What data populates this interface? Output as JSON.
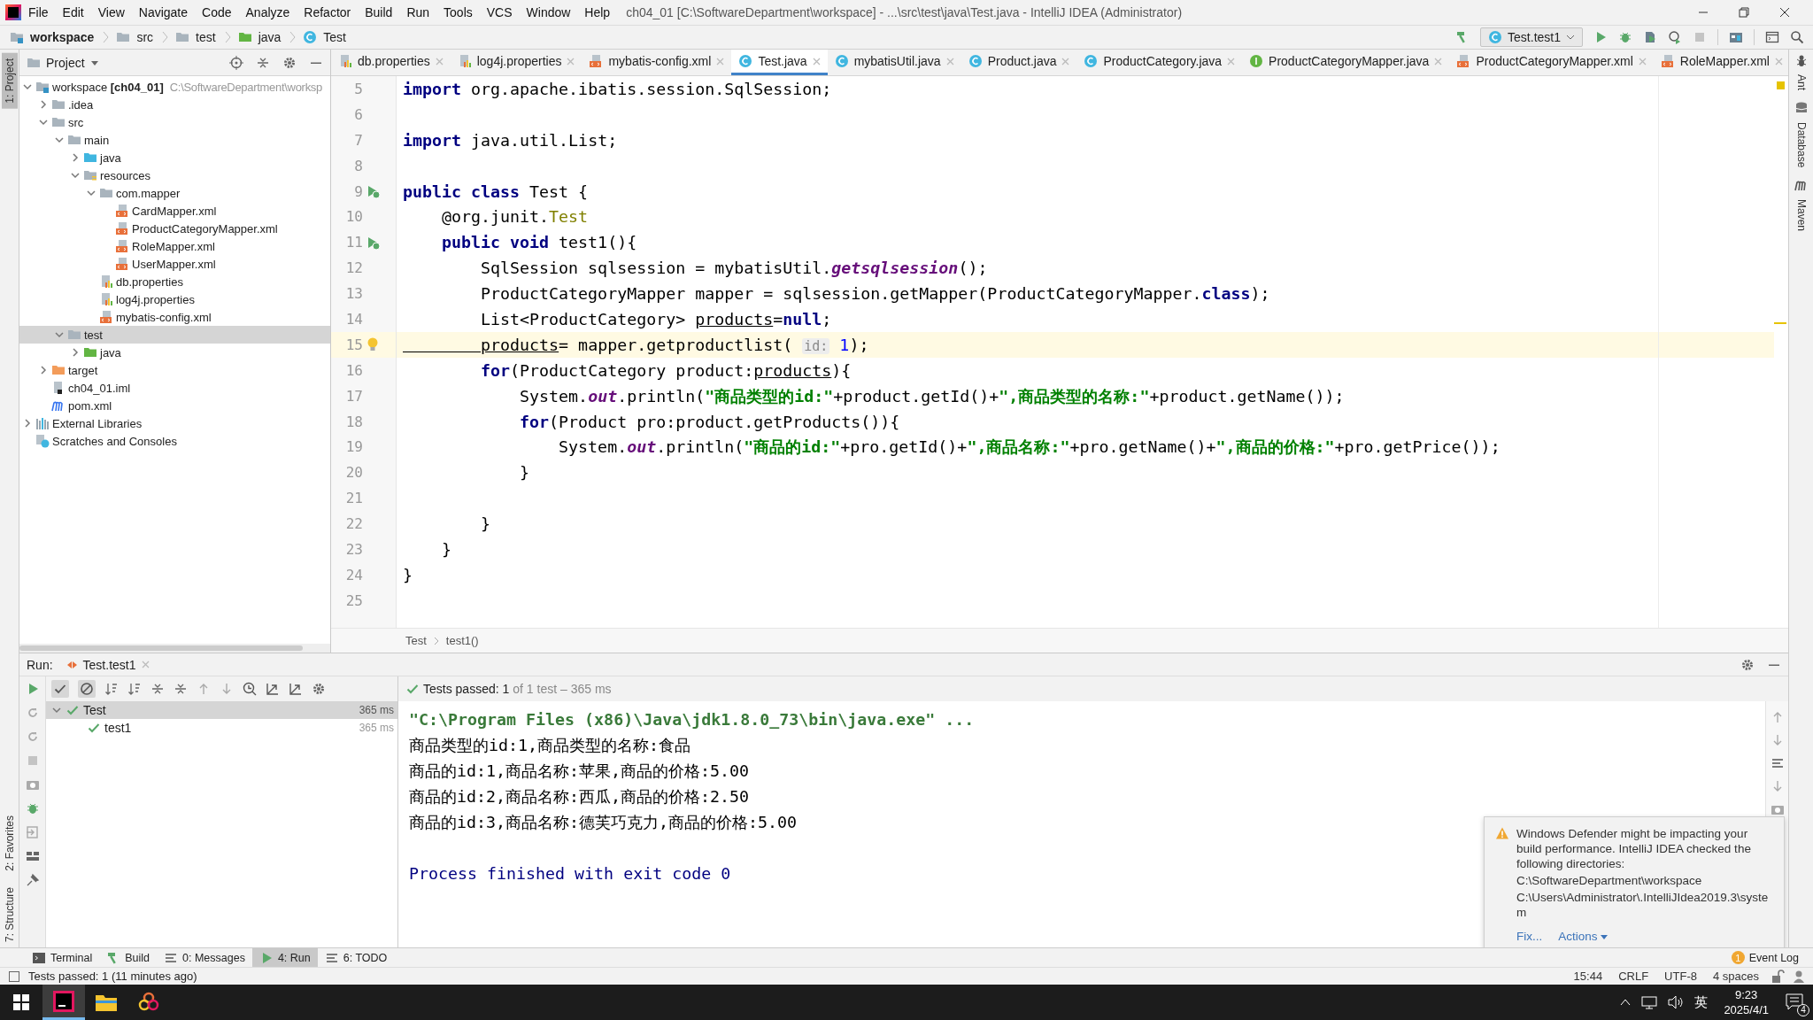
{
  "window": {
    "title": "ch04_01 [C:\\SoftwareDepartment\\workspace] - ...\\src\\test\\java\\Test.java - IntelliJ IDEA (Administrator)",
    "menu": [
      "File",
      "Edit",
      "View",
      "Navigate",
      "Code",
      "Analyze",
      "Refactor",
      "Build",
      "Run",
      "Tools",
      "VCS",
      "Window",
      "Help"
    ]
  },
  "navbar": {
    "crumbs": [
      {
        "label": "workspace",
        "kind": "module"
      },
      {
        "label": "src",
        "kind": "folder"
      },
      {
        "label": "test",
        "kind": "folder"
      },
      {
        "label": "java",
        "kind": "test-folder"
      },
      {
        "label": "Test",
        "kind": "class"
      }
    ],
    "run_config": "Test.test1"
  },
  "left_stripe": [
    {
      "label": "1: Project",
      "selected": true
    },
    {
      "label": "2: Favorites",
      "selected": false
    },
    {
      "label": "7: Structure",
      "selected": false
    }
  ],
  "right_stripe": [
    "Ant",
    "Database",
    "Maven"
  ],
  "project": {
    "title": "Project",
    "tree": [
      {
        "label": "workspace **[ch04_01]**",
        "path": "C:\\SoftwareDepartment\\worksp",
        "kind": "module",
        "expanded": true,
        "selected": false,
        "children": [
          {
            "label": ".idea",
            "kind": "folder",
            "expanded": false,
            "selected": false
          },
          {
            "label": "src",
            "kind": "folder",
            "expanded": true,
            "selected": false,
            "children": [
              {
                "label": "main",
                "kind": "folder",
                "expanded": true,
                "selected": false,
                "children": [
                  {
                    "label": "java",
                    "kind": "src-folder",
                    "expanded": false,
                    "selected": false
                  },
                  {
                    "label": "resources",
                    "kind": "res-folder",
                    "expanded": true,
                    "selected": false,
                    "children": [
                      {
                        "label": "com.mapper",
                        "kind": "folder",
                        "expanded": true,
                        "selected": false,
                        "children": [
                          {
                            "label": "CardMapper.xml",
                            "kind": "xml",
                            "selected": false
                          },
                          {
                            "label": "ProductCategoryMapper.xml",
                            "kind": "xml",
                            "selected": false
                          },
                          {
                            "label": "RoleMapper.xml",
                            "kind": "xml",
                            "selected": false
                          },
                          {
                            "label": "UserMapper.xml",
                            "kind": "xml",
                            "selected": false
                          }
                        ]
                      },
                      {
                        "label": "db.properties",
                        "kind": "properties",
                        "selected": false
                      },
                      {
                        "label": "log4j.properties",
                        "kind": "properties",
                        "selected": false
                      },
                      {
                        "label": "mybatis-config.xml",
                        "kind": "xml",
                        "selected": false
                      }
                    ]
                  }
                ]
              },
              {
                "label": "test",
                "kind": "folder",
                "expanded": true,
                "selected": true,
                "children": [
                  {
                    "label": "java",
                    "kind": "test-folder",
                    "expanded": false,
                    "selected": false
                  }
                ]
              }
            ]
          },
          {
            "label": "target",
            "kind": "excluded-folder",
            "expanded": false,
            "selected": false
          },
          {
            "label": "ch04_01.iml",
            "kind": "iml",
            "selected": false
          },
          {
            "label": "pom.xml",
            "kind": "pom",
            "selected": false
          }
        ]
      },
      {
        "label": "External Libraries",
        "kind": "libraries",
        "expanded": false,
        "selected": false
      },
      {
        "label": "Scratches and Consoles",
        "kind": "scratches",
        "selected": false
      }
    ]
  },
  "editor": {
    "tabs": [
      {
        "label": "db.properties",
        "kind": "properties",
        "selected": false
      },
      {
        "label": "log4j.properties",
        "kind": "properties",
        "selected": false
      },
      {
        "label": "mybatis-config.xml",
        "kind": "xml",
        "selected": false
      },
      {
        "label": "Test.java",
        "kind": "class",
        "selected": true
      },
      {
        "label": "mybatisUtil.java",
        "kind": "class",
        "selected": false
      },
      {
        "label": "Product.java",
        "kind": "class",
        "selected": false
      },
      {
        "label": "ProductCategory.java",
        "kind": "class",
        "selected": false
      },
      {
        "label": "ProductCategoryMapper.java",
        "kind": "interface",
        "selected": false
      },
      {
        "label": "ProductCategoryMapper.xml",
        "kind": "xml",
        "selected": false
      },
      {
        "label": "RoleMapper.xml",
        "kind": "xml",
        "selected": false
      }
    ],
    "lines": [
      {
        "number": "5",
        "kind": "code",
        "current": false,
        "tokens": [
          {
            "kind": "kw",
            "text": "import"
          },
          {
            "kind": "plain",
            "text": " org.apache.ibatis.session.SqlSession;"
          }
        ]
      },
      {
        "number": "6",
        "kind": "code",
        "current": false
      },
      {
        "number": "7",
        "kind": "code",
        "current": false,
        "tokens": [
          {
            "kind": "kw",
            "text": "import"
          },
          {
            "kind": "plain",
            "text": " java.util.List;"
          }
        ]
      },
      {
        "number": "8",
        "kind": "code",
        "current": false
      },
      {
        "number": "9",
        "kind": "run",
        "current": false,
        "tokens": [
          {
            "kind": "kw",
            "text": "public class"
          },
          {
            "kind": "plain",
            "text": " Test {"
          }
        ]
      },
      {
        "number": "10",
        "kind": "code",
        "current": false,
        "tokens": [
          {
            "kind": "plain",
            "text": "    @org.junit."
          },
          {
            "kind": "ann",
            "text": "Test"
          }
        ]
      },
      {
        "number": "11",
        "kind": "run",
        "current": false,
        "tokens": [
          {
            "kind": "kw",
            "text": "    public void"
          },
          {
            "kind": "plain",
            "text": " test1(){"
          }
        ]
      },
      {
        "number": "12",
        "kind": "code",
        "current": false,
        "tokens": [
          {
            "kind": "plain",
            "text": "        SqlSession sqlsession = mybatisUtil."
          },
          {
            "kind": "italic",
            "text": "getsqlsession"
          },
          {
            "kind": "plain",
            "text": "();"
          }
        ]
      },
      {
        "number": "13",
        "kind": "code",
        "current": false,
        "tokens": [
          {
            "kind": "plain",
            "text": "        ProductCategoryMapper mapper = sqlsession.getMapper(ProductCategoryMapper."
          },
          {
            "kind": "kw",
            "text": "class"
          },
          {
            "kind": "plain",
            "text": ");"
          }
        ]
      },
      {
        "number": "14",
        "kind": "code",
        "current": false,
        "tokens": [
          {
            "kind": "plain",
            "text": "        List<ProductCategory> "
          },
          {
            "kind": "var",
            "text": "products"
          },
          {
            "kind": "plain",
            "text": "="
          },
          {
            "kind": "kw",
            "text": "null"
          },
          {
            "kind": "plain",
            "text": ";"
          }
        ]
      },
      {
        "number": "15",
        "kind": "bulb",
        "current": true,
        "tokens": [
          {
            "kind": "var",
            "text": "        products"
          },
          {
            "kind": "plain",
            "text": "= mapper.getproductlist( "
          },
          {
            "kind": "hint",
            "text": "id:"
          },
          {
            "kind": "num",
            "text": " 1"
          },
          {
            "kind": "plain",
            "text": ");"
          }
        ]
      },
      {
        "number": "16",
        "kind": "code",
        "current": false,
        "tokens": [
          {
            "kind": "kw",
            "text": "        for"
          },
          {
            "kind": "plain",
            "text": "(ProductCategory product:"
          },
          {
            "kind": "var",
            "text": "products"
          },
          {
            "kind": "plain",
            "text": "){"
          }
        ]
      },
      {
        "number": "17",
        "kind": "code",
        "current": false,
        "tokens": [
          {
            "kind": "plain",
            "text": "            System."
          },
          {
            "kind": "italic",
            "text": "out"
          },
          {
            "kind": "plain",
            "text": ".println("
          },
          {
            "kind": "str",
            "text": "\"商品类型的id:\""
          },
          {
            "kind": "plain",
            "text": "+product.getId()+"
          },
          {
            "kind": "str",
            "text": "\",商品类型的名称:\""
          },
          {
            "kind": "plain",
            "text": "+product.getName());"
          }
        ]
      },
      {
        "number": "18",
        "kind": "code",
        "current": false,
        "tokens": [
          {
            "kind": "kw",
            "text": "            for"
          },
          {
            "kind": "plain",
            "text": "(Product pro:product.getProducts()){"
          }
        ]
      },
      {
        "number": "19",
        "kind": "code",
        "current": false,
        "tokens": [
          {
            "kind": "plain",
            "text": "                System."
          },
          {
            "kind": "italic",
            "text": "out"
          },
          {
            "kind": "plain",
            "text": ".println("
          },
          {
            "kind": "str",
            "text": "\"商品的id:\""
          },
          {
            "kind": "plain",
            "text": "+pro.getId()+"
          },
          {
            "kind": "str",
            "text": "\",商品名称:\""
          },
          {
            "kind": "plain",
            "text": "+pro.getName()+"
          },
          {
            "kind": "str",
            "text": "\",商品的价格:\""
          },
          {
            "kind": "plain",
            "text": "+pro.getPrice());"
          }
        ]
      },
      {
        "number": "20",
        "kind": "code",
        "current": false,
        "tokens": [
          {
            "kind": "plain",
            "text": "            }"
          }
        ]
      },
      {
        "number": "21",
        "kind": "code",
        "current": false
      },
      {
        "number": "22",
        "kind": "code",
        "current": false,
        "tokens": [
          {
            "kind": "plain",
            "text": "        }"
          }
        ]
      },
      {
        "number": "23",
        "kind": "code",
        "current": false,
        "tokens": [
          {
            "kind": "plain",
            "text": "    }"
          }
        ]
      },
      {
        "number": "24",
        "kind": "code",
        "current": false,
        "tokens": [
          {
            "kind": "plain",
            "text": "}"
          }
        ]
      },
      {
        "number": "25",
        "kind": "code",
        "current": false
      }
    ],
    "breadcrumbs": [
      "Test",
      "test1()"
    ]
  },
  "run": {
    "title": "Run:",
    "tab": "Test.test1",
    "status": "Tests passed: 1",
    "status_detail": "of 1 test – 365 ms",
    "tests": [
      {
        "name": "Test",
        "time": "365 ms",
        "selected": true,
        "children": [
          {
            "name": "test1",
            "time": "365 ms",
            "selected": false
          }
        ]
      }
    ],
    "console": [
      {
        "kind": "command",
        "text": "\"C:\\Program Files (x86)\\Java\\jdk1.8.0_73\\bin\\java.exe\" ..."
      },
      {
        "kind": "output",
        "text": "商品类型的id:1,商品类型的名称:食品"
      },
      {
        "kind": "output",
        "text": "商品的id:1,商品名称:苹果,商品的价格:5.00"
      },
      {
        "kind": "output",
        "text": "商品的id:2,商品名称:西瓜,商品的价格:2.50"
      },
      {
        "kind": "output",
        "text": "商品的id:3,商品名称:德芙巧克力,商品的价格:5.00"
      },
      {
        "kind": "exit",
        "text": "Process finished with exit code 0"
      }
    ]
  },
  "notification": {
    "message": "Windows Defender might be impacting your build performance. IntelliJ IDEA checked the following directories:",
    "paths": [
      "C:\\SoftwareDepartment\\workspace",
      "C:\\Users\\Administrator\\.IntelliJIdea2019.3\\system"
    ],
    "links": [
      "Fix...",
      "Actions"
    ]
  },
  "tool_tabs": [
    {
      "label": "Terminal",
      "kind": "terminal",
      "selected": false
    },
    {
      "label": "Build",
      "kind": "hammer",
      "selected": false
    },
    {
      "label": "0: Messages",
      "kind": "list",
      "selected": false
    },
    {
      "label": "4: Run",
      "kind": "run",
      "selected": true
    },
    {
      "label": "6: TODO",
      "kind": "list",
      "selected": false
    }
  ],
  "event_log": {
    "label": "Event Log",
    "count": "1"
  },
  "status_bar": {
    "message": "Tests passed: 1 (11 minutes ago)",
    "items": [
      "15:44",
      "CRLF",
      "UTF-8",
      "4 spaces"
    ]
  },
  "taskbar": {
    "apps": [
      {
        "kind": "ide",
        "selected": true
      },
      {
        "kind": "folder",
        "selected": false
      },
      {
        "kind": "petal",
        "selected": false
      }
    ],
    "ime": "英",
    "time": "9:23",
    "date": "2025/4/1",
    "notifications": "4"
  }
}
